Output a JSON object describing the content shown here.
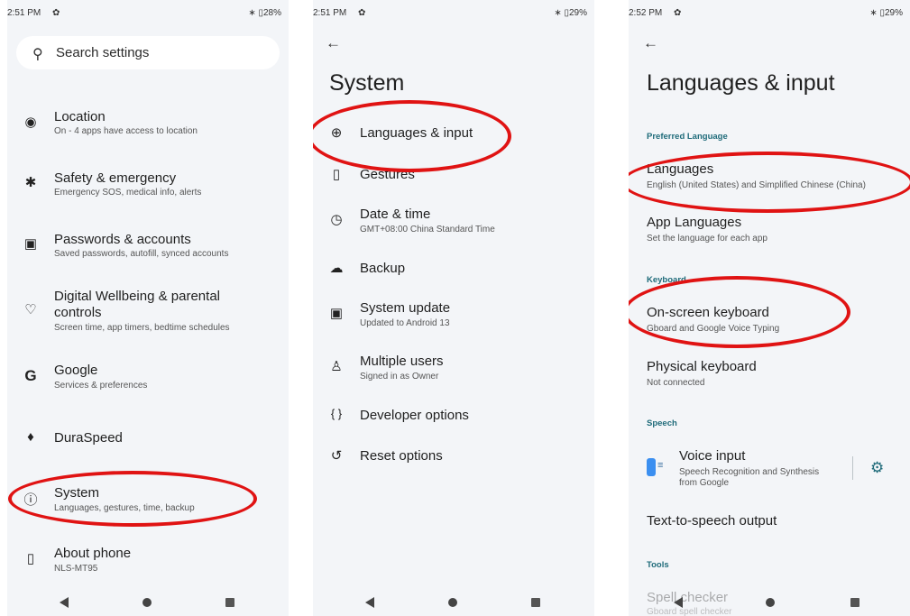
{
  "panel1": {
    "status": {
      "time": "2:51 PM",
      "right": "∗ ▯28%"
    },
    "search": {
      "placeholder": "Search settings"
    },
    "items": [
      {
        "icon": "location-pin-icon",
        "glyph": "◉",
        "title": "Location",
        "subtitle": "On - 4 apps have access to location"
      },
      {
        "icon": "asterisk-icon",
        "glyph": "✱",
        "title": "Safety & emergency",
        "subtitle": "Emergency SOS, medical info, alerts"
      },
      {
        "icon": "account-box-icon",
        "glyph": "▣",
        "title": "Passwords & accounts",
        "subtitle": "Saved passwords, autofill, synced accounts"
      },
      {
        "icon": "wellbeing-icon",
        "glyph": "♡",
        "title": "Digital Wellbeing & parental",
        "title2": "controls",
        "subtitle": "Screen time, app timers, bedtime schedules"
      },
      {
        "icon": "google-icon",
        "glyph": "G",
        "title": "Google",
        "subtitle": "Services & preferences"
      },
      {
        "icon": "rocket-icon",
        "glyph": "♦",
        "title": "DuraSpeed",
        "subtitle": ""
      },
      {
        "icon": "info-icon",
        "glyph": "ⓘ",
        "title": "System",
        "subtitle": "Languages, gestures, time, backup"
      },
      {
        "icon": "phone-icon",
        "glyph": "▯",
        "title": "About phone",
        "subtitle": "NLS-MT95"
      }
    ]
  },
  "panel2": {
    "status": {
      "time": "2:51 PM",
      "right": "∗ ▯29%"
    },
    "back": "←",
    "title": "System",
    "items": [
      {
        "icon": "globe-icon",
        "glyph": "⊕",
        "title": "Languages & input",
        "subtitle": ""
      },
      {
        "icon": "gestures-icon",
        "glyph": "▯",
        "title": "Gestures",
        "subtitle": ""
      },
      {
        "icon": "clock-icon",
        "glyph": "◷",
        "title": "Date & time",
        "subtitle": "GMT+08:00 China Standard Time"
      },
      {
        "icon": "cloud-upload-icon",
        "glyph": "☁",
        "title": "Backup",
        "subtitle": ""
      },
      {
        "icon": "system-update-icon",
        "glyph": "▣",
        "title": "System update",
        "subtitle": "Updated to Android 13"
      },
      {
        "icon": "users-icon",
        "glyph": "♙",
        "title": "Multiple users",
        "subtitle": "Signed in as Owner"
      },
      {
        "icon": "braces-icon",
        "glyph": "{ }",
        "title": "Developer options",
        "subtitle": ""
      },
      {
        "icon": "reset-icon",
        "glyph": "↺",
        "title": "Reset options",
        "subtitle": ""
      }
    ]
  },
  "panel3": {
    "status": {
      "time": "2:52 PM",
      "right": "∗ ▯29%"
    },
    "back": "←",
    "title": "Languages & input",
    "sections": {
      "preferred": "Preferred Language",
      "keyboard": "Keyboard",
      "speech": "Speech",
      "tools": "Tools"
    },
    "items": {
      "languages": {
        "title": "Languages",
        "subtitle": "English (United States) and Simplified Chinese (China)"
      },
      "app_languages": {
        "title": "App Languages",
        "subtitle": "Set the language for each app"
      },
      "onscreen": {
        "title": "On-screen keyboard",
        "subtitle": "Gboard and Google Voice Typing"
      },
      "physical": {
        "title": "Physical keyboard",
        "subtitle": "Not connected"
      },
      "voice": {
        "title": "Voice input",
        "subtitle": "Speech Recognition and Synthesis",
        "subtitle2": "from Google"
      },
      "tts": {
        "title": "Text-to-speech output"
      },
      "spell": {
        "title": "Spell checker",
        "subtitle": "Gboard spell checker"
      }
    }
  },
  "colors": {
    "highlight": "#e01313",
    "accent": "#1f6b7a",
    "background": "#f3f5f8"
  }
}
